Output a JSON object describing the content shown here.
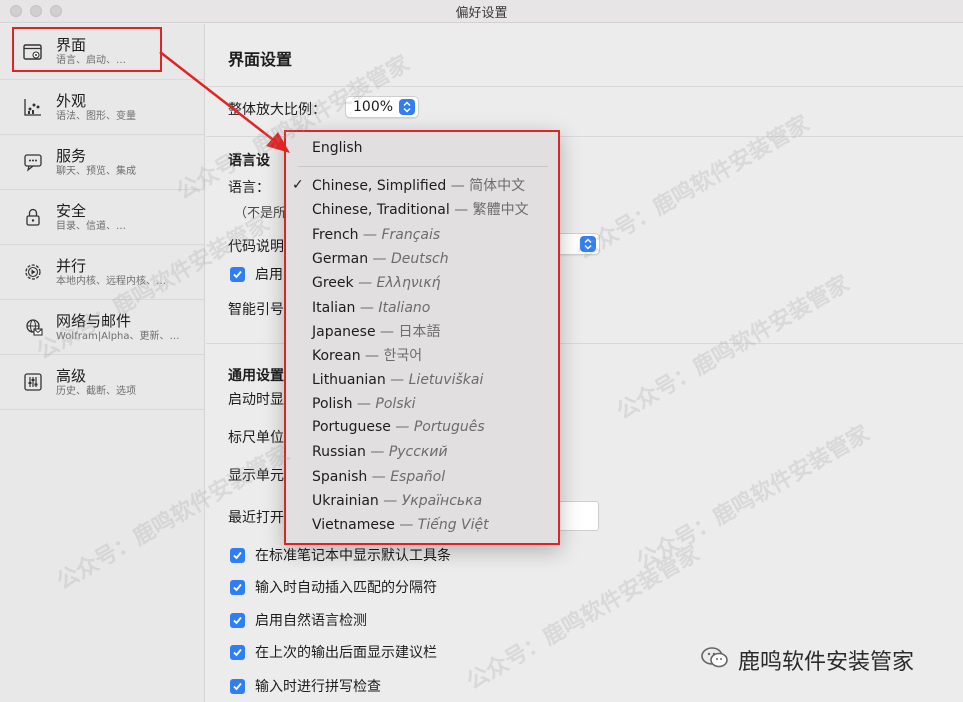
{
  "window": {
    "title": "偏好设置"
  },
  "sidebar": {
    "items": [
      {
        "label": "界面",
        "sub": "语言、启动、…",
        "icon": "window-gear-icon"
      },
      {
        "label": "外观",
        "sub": "语法、图形、变量",
        "icon": "chart-icon"
      },
      {
        "label": "服务",
        "sub": "聊天、预览、集成",
        "icon": "chat-bubble-icon"
      },
      {
        "label": "安全",
        "sub": "目录、信道、…",
        "icon": "lock-icon"
      },
      {
        "label": "并行",
        "sub": "本地内核、远程内核、…",
        "icon": "gear-play-icon"
      },
      {
        "label": "网络与邮件",
        "sub": "Wolfram|Alpha、更新、…",
        "icon": "globe-icon"
      },
      {
        "label": "高级",
        "sub": "历史、截断、选项",
        "icon": "sliders-icon"
      }
    ]
  },
  "main": {
    "title": "界面设置",
    "zoom_label": "整体放大比例：",
    "zoom_value": "100%",
    "language_section": "语言设",
    "language_label": "语言：",
    "language_note": "（不是所",
    "code_label": "代码说明",
    "enable_label": "启用",
    "smart_quotes_label": "智能引号",
    "general_section": "通用设置",
    "startup_label": "启动时显",
    "ruler_label": "标尺单位",
    "display_label": "显示单元",
    "recent_label": "最近打开",
    "checks": [
      "在标准笔记本中显示默认工具条",
      "输入时自动插入匹配的分隔符",
      "启用自然语言检测",
      "在上次的输出后面显示建议栏",
      "输入时进行拼写检查"
    ]
  },
  "language_menu": {
    "items": [
      {
        "name": "English",
        "native": ""
      },
      {
        "name": "Chinese, Simplified",
        "native": "简体中文",
        "checked": true
      },
      {
        "name": "Chinese, Traditional",
        "native": "繁體中文"
      },
      {
        "name": "French",
        "native": "Français"
      },
      {
        "name": "German",
        "native": "Deutsch"
      },
      {
        "name": "Greek",
        "native": "Ελληνική"
      },
      {
        "name": "Italian",
        "native": "Italiano"
      },
      {
        "name": "Japanese",
        "native": "日本語"
      },
      {
        "name": "Korean",
        "native": "한국어"
      },
      {
        "name": "Lithuanian",
        "native": "Lietuviškai"
      },
      {
        "name": "Polish",
        "native": "Polski"
      },
      {
        "name": "Portuguese",
        "native": "Português"
      },
      {
        "name": "Russian",
        "native": "Русский"
      },
      {
        "name": "Spanish",
        "native": "Español"
      },
      {
        "name": "Ukrainian",
        "native": "Українська"
      },
      {
        "name": "Vietnamese",
        "native": "Tiếng Việt"
      }
    ],
    "dash": "—",
    "checkmark": "✓"
  },
  "watermark": {
    "text": "公众号：鹿鸣软件安装管家",
    "brand": "鹿鸣软件安装管家"
  },
  "colors": {
    "accent": "#2f7ef3",
    "highlight": "#e02424"
  }
}
